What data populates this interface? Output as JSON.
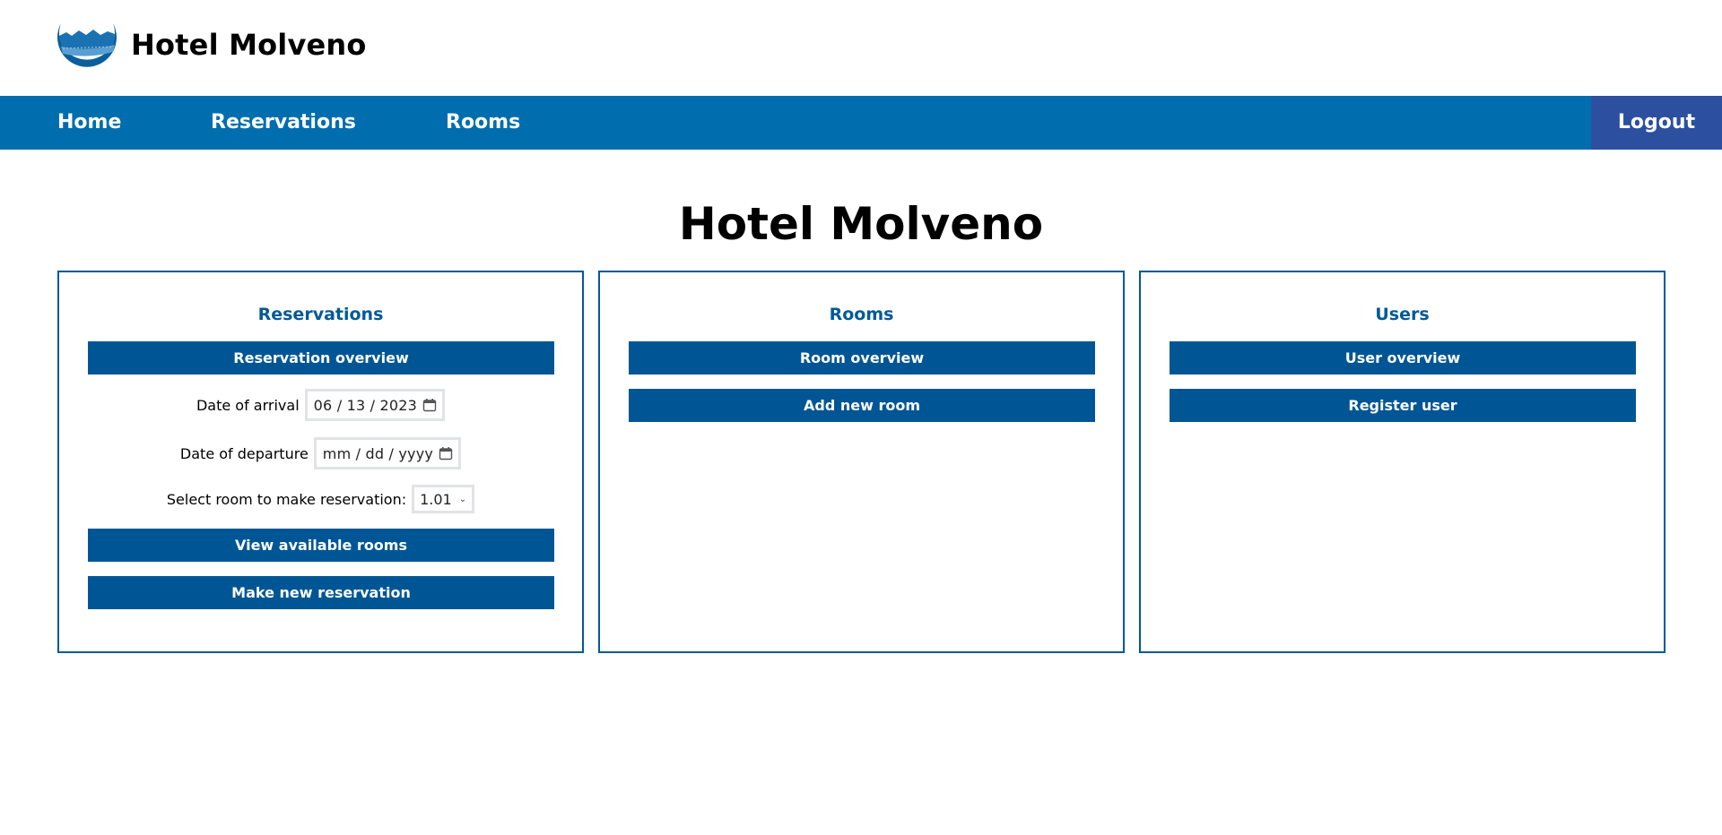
{
  "header": {
    "brand_name": "Hotel Molveno",
    "logo_icon": "hotel-lake-logo-icon"
  },
  "nav": {
    "items": [
      {
        "label": "Home"
      },
      {
        "label": "Reservations"
      },
      {
        "label": "Rooms"
      }
    ],
    "logout_label": "Logout"
  },
  "main": {
    "title": "Hotel Molveno",
    "reservations": {
      "heading": "Reservations",
      "overview_button": "Reservation overview",
      "arrival_label": "Date of arrival",
      "arrival_value": "06 / 13 / 2023",
      "departure_label": "Date of departure",
      "departure_placeholder": "mm / dd / yyyy",
      "room_select_label": "Select room to make reservation:",
      "room_select_value": "1.01",
      "view_rooms_button": "View available rooms",
      "new_reservation_button": "Make new reservation"
    },
    "rooms": {
      "heading": "Rooms",
      "overview_button": "Room overview",
      "add_button": "Add new room"
    },
    "users": {
      "heading": "Users",
      "overview_button": "User overview",
      "register_button": "Register user"
    }
  },
  "colors": {
    "nav_bg": "#006eae",
    "logout_bg": "#2d4fa0",
    "button_bg": "#005694",
    "panel_border": "#005a96",
    "heading": "#005a96"
  }
}
